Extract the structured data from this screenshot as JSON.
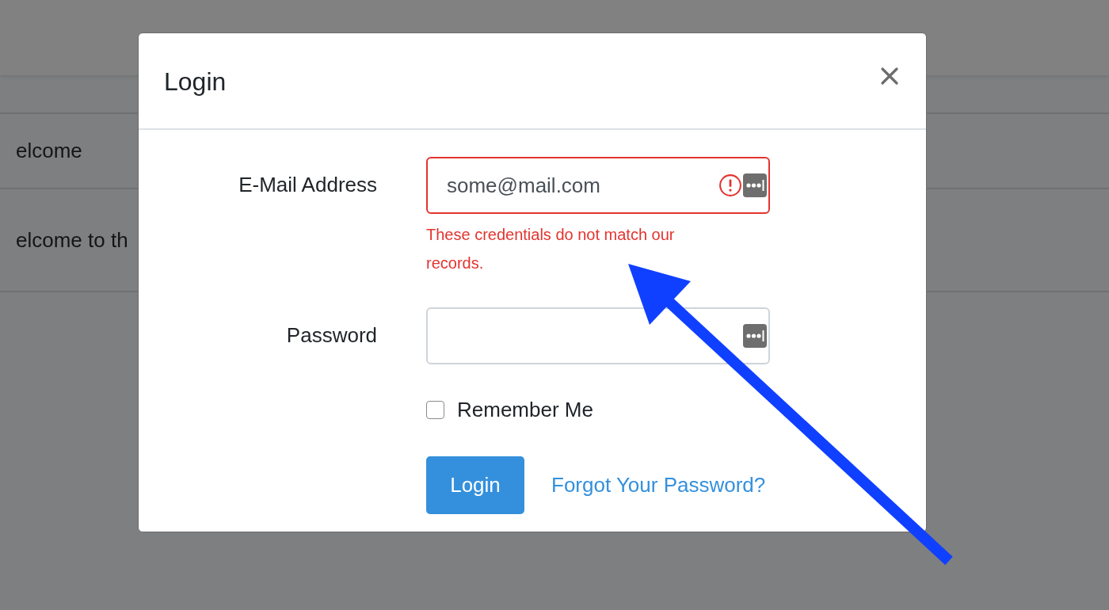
{
  "page": {
    "card": {
      "header": "elcome",
      "body": "elcome to th"
    }
  },
  "modal": {
    "title": "Login",
    "fields": [
      {
        "label": "E-Mail Address",
        "value": "some@mail.com",
        "invalid": true,
        "error": "These credentials do not match our records."
      },
      {
        "label": "Password",
        "invalid": false
      }
    ],
    "remember": {
      "label": "Remember Me",
      "checked": false
    },
    "submit": "Login",
    "link": "Forgot Your Password?"
  }
}
